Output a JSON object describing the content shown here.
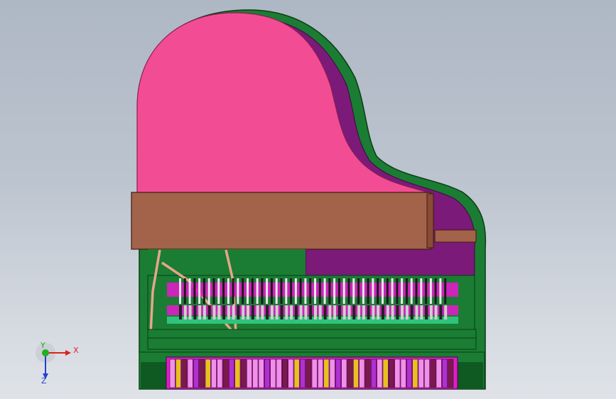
{
  "viewport": {
    "background_top": "#aeb7c4",
    "background_bottom": "#dfe3e8"
  },
  "model": {
    "colors": {
      "lid_pink": "#f24d94",
      "case_green": "#1a7d33",
      "case_dark_green": "#0f5a22",
      "inner_purple": "#7b1a78",
      "fallboard_brown": "#a3624a",
      "strut_salmon": "#e8a68a",
      "action_magenta": "#e01cc8",
      "key_white": "#f090e8",
      "key_black": "#7a1a4a",
      "key_accent": "#e8c020"
    },
    "key_count": 48,
    "hammer_count": 56
  },
  "triad": {
    "x_label": "X",
    "y_label": "Y",
    "z_label": "Z",
    "x_color": "#e02020",
    "y_color": "#20b020",
    "z_color": "#2040d0"
  }
}
